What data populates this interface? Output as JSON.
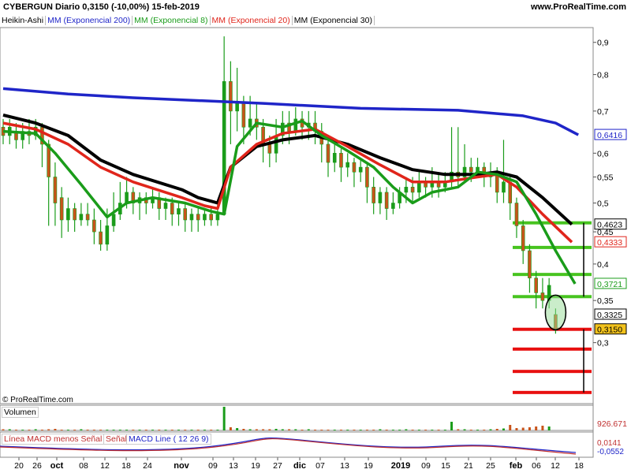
{
  "header": {
    "symbol": "CYBERGUN",
    "period": "Diario",
    "info": "0,3150 (-10,00%)",
    "date": "15-feb-2019",
    "site": "www.ProRealTime.com"
  },
  "legend": [
    {
      "label": "Heikin-Ashi",
      "color": "#000000"
    },
    {
      "label": "MM (Exponencial 200)",
      "color": "#1f25c8"
    },
    {
      "label": "MM (Exponencial 8)",
      "color": "#1a9c1a"
    },
    {
      "label": "MM (Exponencial 20)",
      "color": "#e0251b"
    },
    {
      "label": "MM (Exponencial 30)",
      "color": "#000000"
    }
  ],
  "copyright": "© ProRealTime.com",
  "volume_label": "Volumen",
  "volume_value": "926.671",
  "macd_labels": {
    "hist": "Línea MACD menos Señal",
    "signal": "Señal",
    "line": "MACD Line ( 12 26 9)"
  },
  "macd_values": [
    "0,0141",
    "-0,0552"
  ],
  "colors": {
    "up": "#1a9c1a",
    "down": "#c8541b",
    "ema200": "#1f25c8",
    "ema8": "#1a9c1a",
    "ema20": "#e0251b",
    "ema30": "#000000",
    "support": "#e81010",
    "resist": "#47c41f"
  },
  "chart_data": {
    "type": "candlestick",
    "title": "CYBERGUN Diario",
    "y_ticks": [
      "0,9",
      "0,8",
      "0,7",
      "0,6",
      "0,55",
      "0,5",
      "0,45",
      "0,4",
      "0,35",
      "0,3"
    ],
    "x_ticks": [
      "20",
      "26",
      "oct",
      "08",
      "12",
      "18",
      "24",
      "nov",
      "09",
      "13",
      "19",
      "27",
      "dic",
      "07",
      "13",
      "19",
      "2019",
      "09",
      "15",
      "21",
      "25",
      "feb",
      "06",
      "12",
      "18"
    ],
    "ylim": [
      0.24,
      0.95
    ],
    "y_scale": "log",
    "price_labels": [
      {
        "text": "0,6416",
        "value": 0.6416,
        "series": "ema200"
      },
      {
        "text": "0,4623",
        "value": 0.4623,
        "series": "ema30"
      },
      {
        "text": "0,4333",
        "value": 0.4333,
        "series": "ema20"
      },
      {
        "text": "0,3721",
        "value": 0.3721,
        "series": "ema8"
      },
      {
        "text": "0,3325",
        "value": 0.3325,
        "series": "open"
      },
      {
        "text": "0,3150",
        "value": 0.315,
        "series": "last"
      }
    ],
    "ema200": [
      [
        0,
        0.76
      ],
      [
        20,
        0.745
      ],
      [
        40,
        0.735
      ],
      [
        80,
        0.72
      ],
      [
        110,
        0.707
      ],
      [
        140,
        0.702
      ],
      [
        160,
        0.688
      ],
      [
        170,
        0.67
      ],
      [
        177,
        0.6416
      ]
    ],
    "ema30": [
      [
        0,
        0.69
      ],
      [
        10,
        0.67
      ],
      [
        20,
        0.64
      ],
      [
        30,
        0.585
      ],
      [
        40,
        0.555
      ],
      [
        55,
        0.525
      ],
      [
        60,
        0.51
      ],
      [
        66,
        0.5
      ],
      [
        70,
        0.57
      ],
      [
        78,
        0.615
      ],
      [
        86,
        0.63
      ],
      [
        96,
        0.64
      ],
      [
        106,
        0.62
      ],
      [
        116,
        0.59
      ],
      [
        126,
        0.565
      ],
      [
        136,
        0.555
      ],
      [
        146,
        0.555
      ],
      [
        152,
        0.56
      ],
      [
        158,
        0.55
      ],
      [
        166,
        0.51
      ],
      [
        175,
        0.4623
      ]
    ],
    "ema20": [
      [
        0,
        0.67
      ],
      [
        10,
        0.655
      ],
      [
        20,
        0.62
      ],
      [
        30,
        0.57
      ],
      [
        40,
        0.54
      ],
      [
        55,
        0.51
      ],
      [
        62,
        0.495
      ],
      [
        66,
        0.49
      ],
      [
        70,
        0.57
      ],
      [
        78,
        0.62
      ],
      [
        86,
        0.645
      ],
      [
        96,
        0.655
      ],
      [
        106,
        0.615
      ],
      [
        116,
        0.575
      ],
      [
        126,
        0.54
      ],
      [
        136,
        0.54
      ],
      [
        146,
        0.55
      ],
      [
        152,
        0.555
      ],
      [
        158,
        0.53
      ],
      [
        166,
        0.48
      ],
      [
        175,
        0.4333
      ]
    ],
    "ema8": [
      [
        0,
        0.65
      ],
      [
        10,
        0.645
      ],
      [
        16,
        0.6
      ],
      [
        24,
        0.535
      ],
      [
        32,
        0.475
      ],
      [
        38,
        0.5
      ],
      [
        46,
        0.51
      ],
      [
        56,
        0.5
      ],
      [
        64,
        0.485
      ],
      [
        68,
        0.48
      ],
      [
        72,
        0.615
      ],
      [
        78,
        0.67
      ],
      [
        86,
        0.66
      ],
      [
        92,
        0.675
      ],
      [
        98,
        0.64
      ],
      [
        106,
        0.605
      ],
      [
        114,
        0.57
      ],
      [
        120,
        0.53
      ],
      [
        126,
        0.5
      ],
      [
        132,
        0.52
      ],
      [
        140,
        0.53
      ],
      [
        146,
        0.56
      ],
      [
        152,
        0.555
      ],
      [
        158,
        0.54
      ],
      [
        164,
        0.48
      ],
      [
        170,
        0.42
      ],
      [
        176,
        0.3721
      ]
    ],
    "candles": [
      [
        0,
        0.66,
        0.64,
        0.68,
        0.62
      ],
      [
        2,
        0.64,
        0.66,
        0.68,
        0.62
      ],
      [
        4,
        0.65,
        0.63,
        0.67,
        0.61
      ],
      [
        6,
        0.63,
        0.65,
        0.67,
        0.61
      ],
      [
        8,
        0.65,
        0.64,
        0.68,
        0.62
      ],
      [
        10,
        0.64,
        0.66,
        0.68,
        0.63
      ],
      [
        12,
        0.66,
        0.62,
        0.67,
        0.57
      ],
      [
        14,
        0.62,
        0.55,
        0.63,
        0.46
      ],
      [
        16,
        0.55,
        0.5,
        0.58,
        0.46
      ],
      [
        18,
        0.51,
        0.47,
        0.53,
        0.44
      ],
      [
        20,
        0.47,
        0.49,
        0.51,
        0.45
      ],
      [
        22,
        0.49,
        0.47,
        0.5,
        0.45
      ],
      [
        24,
        0.47,
        0.48,
        0.5,
        0.46
      ],
      [
        26,
        0.48,
        0.47,
        0.5,
        0.46
      ],
      [
        28,
        0.47,
        0.45,
        0.49,
        0.43
      ],
      [
        30,
        0.45,
        0.43,
        0.47,
        0.42
      ],
      [
        32,
        0.43,
        0.46,
        0.49,
        0.42
      ],
      [
        34,
        0.46,
        0.48,
        0.52,
        0.45
      ],
      [
        36,
        0.48,
        0.5,
        0.54,
        0.47
      ],
      [
        38,
        0.5,
        0.52,
        0.55,
        0.49
      ],
      [
        40,
        0.52,
        0.5,
        0.53,
        0.48
      ],
      [
        42,
        0.5,
        0.51,
        0.52,
        0.47
      ],
      [
        44,
        0.51,
        0.5,
        0.52,
        0.48
      ],
      [
        46,
        0.5,
        0.51,
        0.53,
        0.49
      ],
      [
        48,
        0.51,
        0.49,
        0.52,
        0.47
      ],
      [
        50,
        0.49,
        0.5,
        0.51,
        0.47
      ],
      [
        52,
        0.5,
        0.48,
        0.51,
        0.46
      ],
      [
        54,
        0.48,
        0.49,
        0.5,
        0.46
      ],
      [
        56,
        0.49,
        0.47,
        0.5,
        0.45
      ],
      [
        58,
        0.47,
        0.48,
        0.49,
        0.45
      ],
      [
        60,
        0.48,
        0.47,
        0.49,
        0.45
      ],
      [
        62,
        0.47,
        0.48,
        0.49,
        0.46
      ],
      [
        64,
        0.48,
        0.47,
        0.49,
        0.46
      ],
      [
        66,
        0.47,
        0.48,
        0.5,
        0.46
      ],
      [
        68,
        0.48,
        0.78,
        0.92,
        0.48
      ],
      [
        70,
        0.78,
        0.7,
        0.84,
        0.62
      ],
      [
        72,
        0.7,
        0.72,
        0.82,
        0.65
      ],
      [
        74,
        0.72,
        0.66,
        0.74,
        0.62
      ],
      [
        76,
        0.66,
        0.68,
        0.74,
        0.64
      ],
      [
        78,
        0.68,
        0.66,
        0.72,
        0.63
      ],
      [
        80,
        0.66,
        0.62,
        0.68,
        0.58
      ],
      [
        82,
        0.62,
        0.6,
        0.64,
        0.57
      ],
      [
        84,
        0.6,
        0.64,
        0.68,
        0.58
      ],
      [
        86,
        0.64,
        0.67,
        0.7,
        0.62
      ],
      [
        88,
        0.67,
        0.65,
        0.7,
        0.62
      ],
      [
        90,
        0.65,
        0.68,
        0.71,
        0.64
      ],
      [
        92,
        0.68,
        0.66,
        0.7,
        0.63
      ],
      [
        94,
        0.66,
        0.67,
        0.7,
        0.63
      ],
      [
        96,
        0.67,
        0.65,
        0.7,
        0.62
      ],
      [
        98,
        0.65,
        0.62,
        0.67,
        0.58
      ],
      [
        100,
        0.62,
        0.58,
        0.63,
        0.55
      ],
      [
        102,
        0.58,
        0.6,
        0.62,
        0.56
      ],
      [
        104,
        0.6,
        0.57,
        0.61,
        0.54
      ],
      [
        106,
        0.57,
        0.58,
        0.6,
        0.55
      ],
      [
        108,
        0.58,
        0.56,
        0.59,
        0.53
      ],
      [
        110,
        0.56,
        0.57,
        0.59,
        0.54
      ],
      [
        112,
        0.57,
        0.53,
        0.58,
        0.5
      ],
      [
        114,
        0.53,
        0.5,
        0.55,
        0.48
      ],
      [
        116,
        0.5,
        0.52,
        0.53,
        0.48
      ],
      [
        118,
        0.52,
        0.49,
        0.53,
        0.47
      ],
      [
        120,
        0.49,
        0.5,
        0.52,
        0.48
      ],
      [
        122,
        0.5,
        0.52,
        0.53,
        0.49
      ],
      [
        124,
        0.52,
        0.53,
        0.55,
        0.5
      ],
      [
        126,
        0.53,
        0.52,
        0.55,
        0.5
      ],
      [
        128,
        0.52,
        0.54,
        0.56,
        0.51
      ],
      [
        130,
        0.54,
        0.53,
        0.55,
        0.51
      ],
      [
        132,
        0.53,
        0.54,
        0.57,
        0.51
      ],
      [
        134,
        0.54,
        0.53,
        0.56,
        0.51
      ],
      [
        136,
        0.53,
        0.54,
        0.56,
        0.52
      ],
      [
        138,
        0.54,
        0.56,
        0.66,
        0.53
      ],
      [
        140,
        0.56,
        0.55,
        0.66,
        0.53
      ],
      [
        142,
        0.55,
        0.57,
        0.62,
        0.54
      ],
      [
        144,
        0.57,
        0.56,
        0.59,
        0.54
      ],
      [
        146,
        0.56,
        0.57,
        0.59,
        0.55
      ],
      [
        148,
        0.57,
        0.55,
        0.58,
        0.53
      ],
      [
        150,
        0.55,
        0.56,
        0.58,
        0.53
      ],
      [
        152,
        0.56,
        0.52,
        0.57,
        0.5
      ],
      [
        154,
        0.52,
        0.54,
        0.63,
        0.5
      ],
      [
        156,
        0.54,
        0.5,
        0.55,
        0.47
      ],
      [
        158,
        0.5,
        0.46,
        0.51,
        0.44
      ],
      [
        160,
        0.46,
        0.42,
        0.47,
        0.4
      ],
      [
        162,
        0.42,
        0.38,
        0.43,
        0.36
      ],
      [
        164,
        0.38,
        0.36,
        0.39,
        0.34
      ],
      [
        166,
        0.36,
        0.35,
        0.38,
        0.34
      ],
      [
        168,
        0.35,
        0.37,
        0.38,
        0.34
      ],
      [
        170,
        0.3325,
        0.315,
        0.34,
        0.31
      ]
    ],
    "support_levels": [
      0.315,
      0.293,
      0.27,
      0.25
    ],
    "resistance_levels": [
      0.465,
      0.425,
      0.385,
      0.355
    ],
    "volume": [
      3,
      3,
      2,
      2,
      2,
      3,
      2,
      3,
      4,
      2,
      2,
      2,
      3,
      2,
      2,
      2,
      2,
      2,
      2,
      2,
      2,
      2,
      2,
      2,
      2,
      2,
      2,
      2,
      2,
      2,
      2,
      2,
      2,
      2,
      60,
      8,
      6,
      4,
      3,
      3,
      3,
      3,
      4,
      3,
      3,
      3,
      2,
      3,
      2,
      2,
      2,
      2,
      2,
      2,
      2,
      2,
      2,
      2,
      3,
      2,
      2,
      2,
      3,
      2,
      2,
      2,
      2,
      2,
      2,
      22,
      3,
      3,
      2,
      2,
      2,
      3,
      4,
      5,
      14,
      6,
      7,
      8,
      10,
      12,
      10
    ],
    "volume_ylim": [
      0,
      60
    ]
  }
}
